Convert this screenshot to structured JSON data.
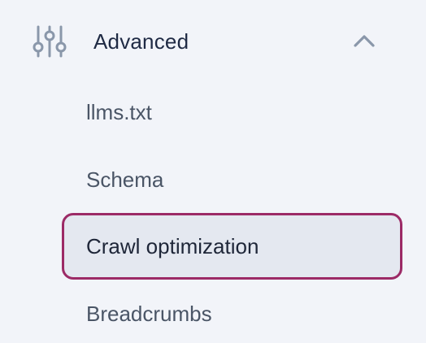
{
  "colors": {
    "background": "#f2f4f9",
    "active_border": "#9c2a66",
    "active_background": "#e4e8f0",
    "icon": "#8a97aa",
    "text_primary": "#1f2a44",
    "text_secondary": "#4a5566"
  },
  "section": {
    "icon": "sliders-icon",
    "label": "Advanced",
    "expanded": true,
    "toggle_icon": "chevron-up-icon"
  },
  "items": [
    {
      "label": "llms.txt",
      "active": false
    },
    {
      "label": "Schema",
      "active": false
    },
    {
      "label": "Crawl optimization",
      "active": true
    },
    {
      "label": "Breadcrumbs",
      "active": false
    }
  ]
}
